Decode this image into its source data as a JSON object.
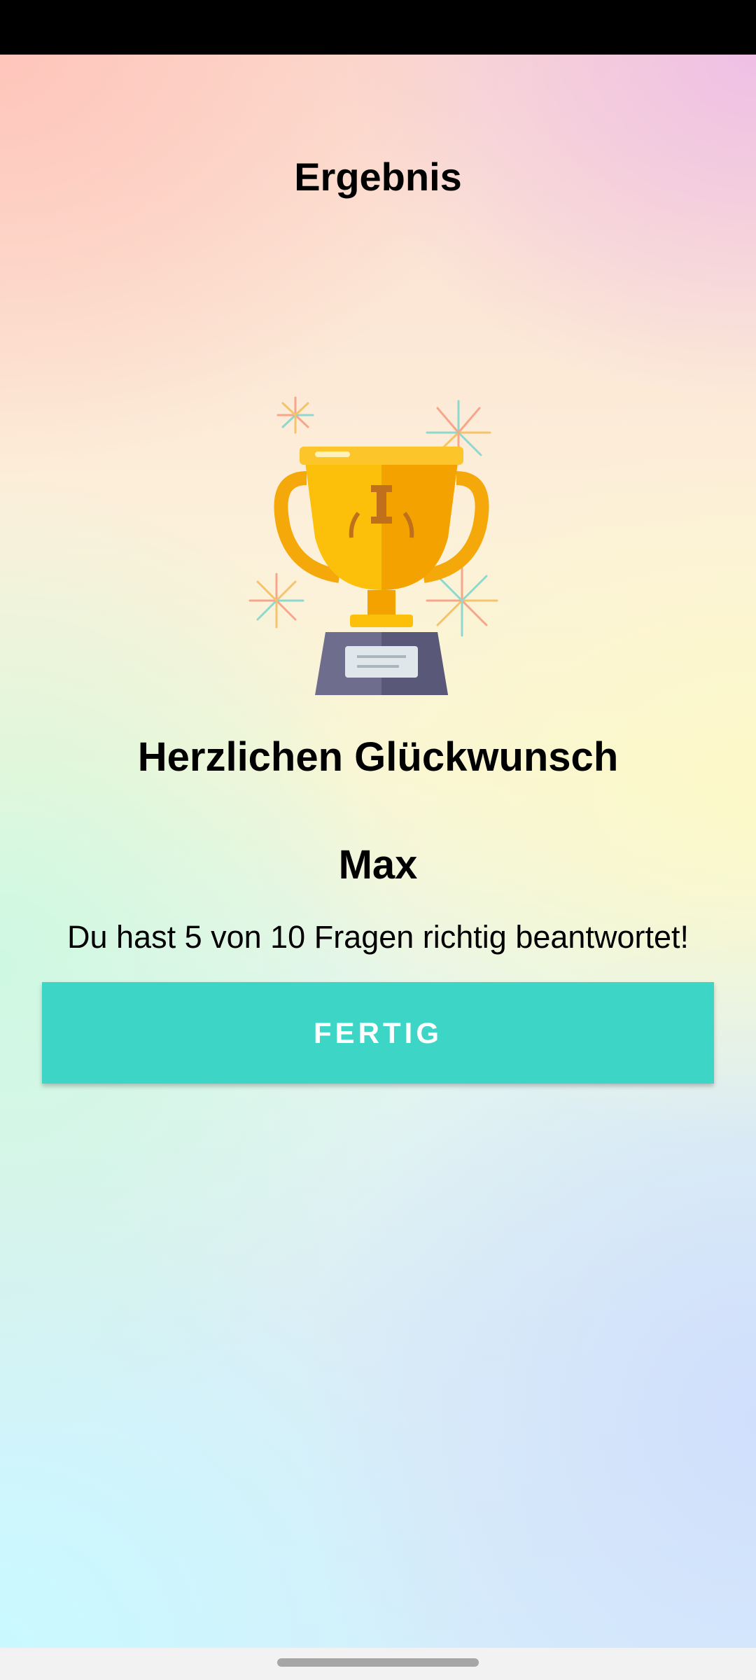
{
  "screen": {
    "title": "Ergebnis",
    "congrats_text": "Herzlichen Glückwunsch",
    "player_name": "Max",
    "result_text": "Du hast 5 von 10 Fragen richtig beantwortet!",
    "done_button_label": "FERTIG",
    "illustration": "trophy-icon"
  },
  "colors": {
    "button": "#3dd5c6",
    "button_text": "#ffffff",
    "trophy_gold": "#fcbf0a",
    "trophy_base": "#6f6d8e"
  }
}
